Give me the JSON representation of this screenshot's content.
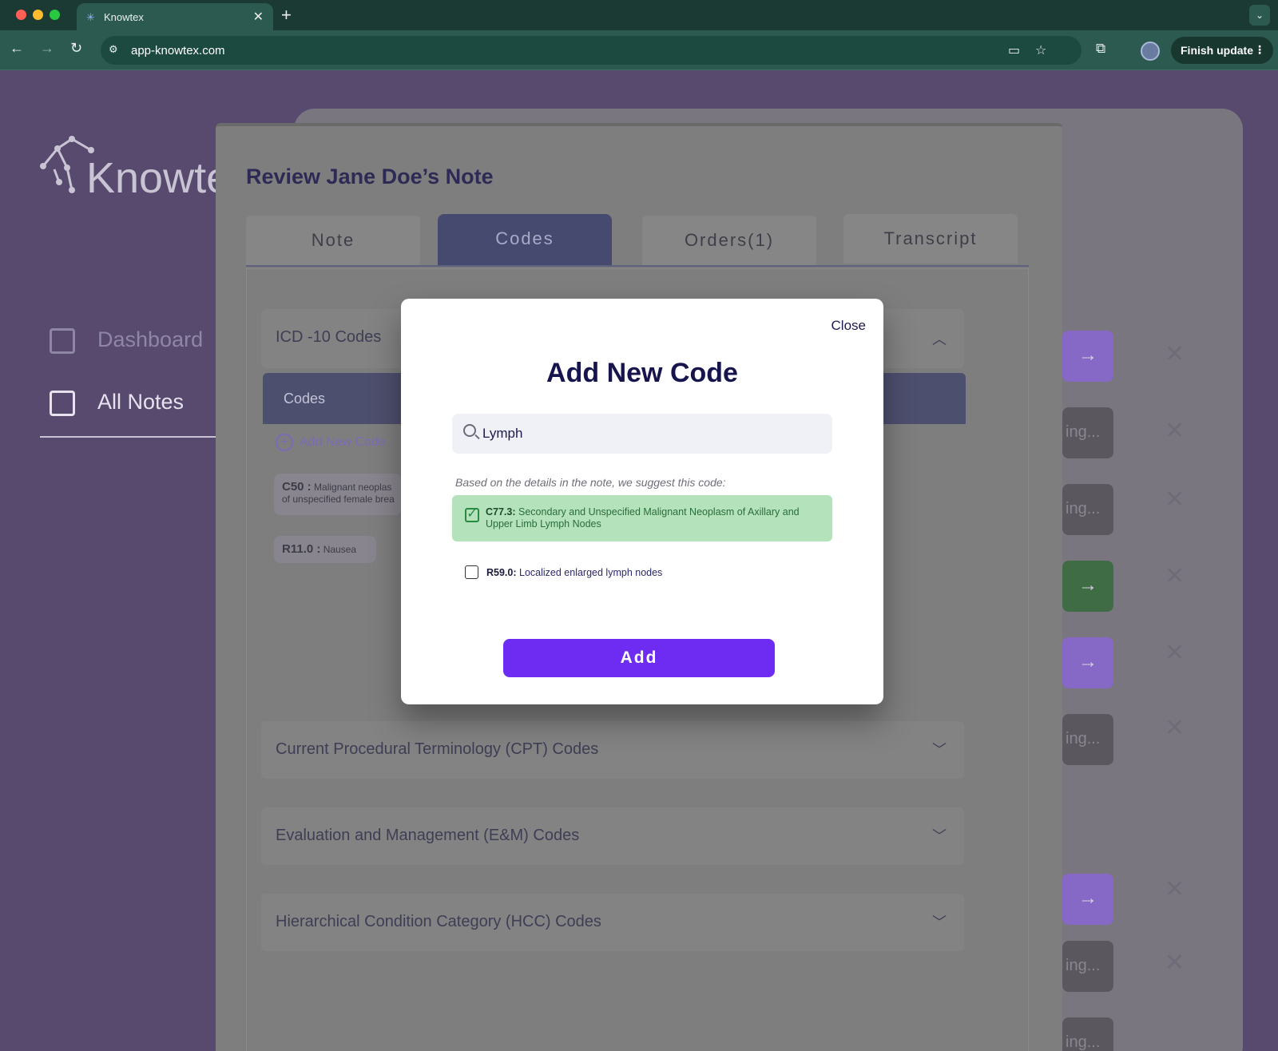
{
  "browser": {
    "tab_title": "Knowtex",
    "url": "app-knowtex.com",
    "finish_update": "Finish update"
  },
  "app": {
    "logo_text": "Knowtex",
    "sidebar": [
      {
        "label": "Dashboard"
      },
      {
        "label": "All Notes"
      }
    ],
    "background_status": "ing...",
    "review": {
      "title": "Review Jane Doe’s Note",
      "tabs": [
        {
          "label": "Note"
        },
        {
          "label": "Codes"
        },
        {
          "label": "Orders(1)"
        },
        {
          "label": "Transcript"
        }
      ],
      "sections": {
        "icd": "ICD -10 Codes",
        "cpt": "Current Procedural Terminology (CPT) Codes",
        "em": "Evaluation and Management (E&M) Codes",
        "hcc": "Hierarchical Condition Category (HCC) Codes"
      },
      "codes_header": "Codes",
      "add_new_code": "Add New Code",
      "chips": [
        {
          "code": "C50 :",
          "desc": "Malignant neoplas",
          "desc2": "of unspecified female brea"
        },
        {
          "code": "R11.0 :",
          "desc": "Nausea"
        }
      ]
    }
  },
  "modal": {
    "close": "Close",
    "title": "Add New Code",
    "search_value": "Lymph",
    "suggest_label": "Based on the details in the note, we suggest this code:",
    "suggested": {
      "code": "C77.3:",
      "desc": "Secondary and Unspecified Malignant Neoplasm of Axillary and Upper Limb Lymph Nodes",
      "checked": true
    },
    "options": [
      {
        "code": "R59.0:",
        "desc": "Localized enlarged lymph nodes",
        "checked": false
      }
    ],
    "add_button": "Add"
  },
  "colors": {
    "accent": "#6e2bf2",
    "suggest_bg": "#b3e2bb",
    "browser_frame": "#2c5a50"
  }
}
